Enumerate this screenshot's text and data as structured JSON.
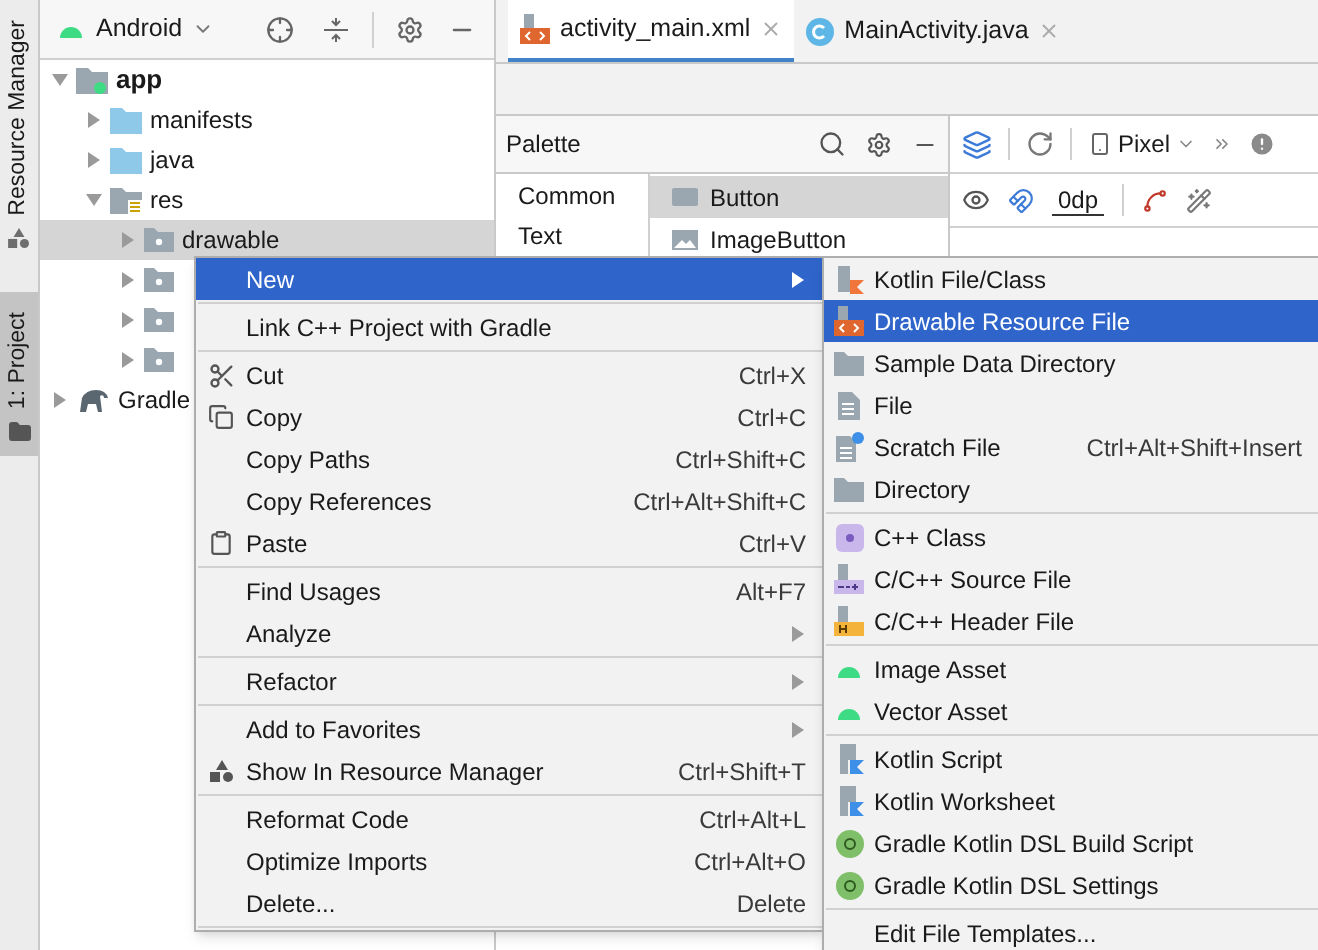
{
  "side_tabs": [
    {
      "label": "Resource Manager",
      "selected": false
    },
    {
      "label": "1: Project",
      "selected": true
    }
  ],
  "project_panel": {
    "view": "Android",
    "tree": [
      {
        "label": "app",
        "kind": "module",
        "expanded": true,
        "selected": false,
        "children": [
          {
            "label": "manifests",
            "kind": "source-folder",
            "expanded": false,
            "selected": false
          },
          {
            "label": "java",
            "kind": "source-folder",
            "expanded": false,
            "selected": false
          },
          {
            "label": "res",
            "kind": "res-folder",
            "expanded": true,
            "selected": false,
            "children": [
              {
                "label": "drawable",
                "kind": "folder",
                "expanded": false,
                "selected": true
              },
              {
                "kind": "folder",
                "expanded": false,
                "selected": false
              },
              {
                "kind": "folder",
                "expanded": false,
                "selected": false
              },
              {
                "kind": "folder",
                "expanded": false,
                "selected": false
              }
            ]
          }
        ]
      },
      {
        "label": "Gradle",
        "kind": "gradle",
        "expanded": false,
        "selected": false
      }
    ]
  },
  "editor_tabs": [
    {
      "label": "activity_main.xml",
      "kind": "xml",
      "selected": true
    },
    {
      "label": "MainActivity.java",
      "kind": "class",
      "selected": false
    }
  ],
  "palette": {
    "title": "Palette",
    "categories": [
      {
        "label": "Common",
        "selected": false
      },
      {
        "label": "Text",
        "selected": false
      }
    ],
    "items": [
      {
        "label": "Button",
        "kind": "button",
        "selected": true
      },
      {
        "label": "ImageButton",
        "kind": "image",
        "selected": false
      }
    ]
  },
  "design_toolbar": {
    "device": "Pixel",
    "margin": "0dp"
  },
  "context_menu": {
    "items": [
      {
        "kind": "item",
        "label": "New",
        "submenu": true,
        "selected": true
      },
      {
        "kind": "separator"
      },
      {
        "kind": "item",
        "label": "Link C++ Project with Gradle",
        "selected": false
      },
      {
        "kind": "separator"
      },
      {
        "kind": "cut",
        "label": "Cut",
        "shortcut": "Ctrl+X",
        "selected": false
      },
      {
        "kind": "copy",
        "label": "Copy",
        "shortcut": "Ctrl+C",
        "selected": false
      },
      {
        "kind": "item",
        "label": "Copy Paths",
        "shortcut": "Ctrl+Shift+C",
        "selected": false
      },
      {
        "kind": "item",
        "label": "Copy References",
        "shortcut": "Ctrl+Alt+Shift+C",
        "selected": false
      },
      {
        "kind": "paste",
        "label": "Paste",
        "shortcut": "Ctrl+V",
        "selected": false
      },
      {
        "kind": "separator"
      },
      {
        "kind": "item",
        "label": "Find Usages",
        "shortcut": "Alt+F7",
        "selected": false
      },
      {
        "kind": "item",
        "label": "Analyze",
        "submenu": true,
        "selected": false
      },
      {
        "kind": "separator"
      },
      {
        "kind": "item",
        "label": "Refactor",
        "submenu": true,
        "selected": false
      },
      {
        "kind": "separator"
      },
      {
        "kind": "item",
        "label": "Add to Favorites",
        "submenu": true,
        "selected": false
      },
      {
        "kind": "resource",
        "label": "Show In Resource Manager",
        "shortcut": "Ctrl+Shift+T",
        "selected": false
      },
      {
        "kind": "separator"
      },
      {
        "kind": "item",
        "label": "Reformat Code",
        "shortcut": "Ctrl+Alt+L",
        "selected": false
      },
      {
        "kind": "item",
        "label": "Optimize Imports",
        "shortcut": "Ctrl+Alt+O",
        "selected": false
      },
      {
        "kind": "item",
        "label": "Delete...",
        "shortcut": "Delete",
        "selected": false
      },
      {
        "kind": "separator"
      }
    ]
  },
  "new_submenu": {
    "items": [
      {
        "kind": "kotlin",
        "label": "Kotlin File/Class",
        "selected": false
      },
      {
        "kind": "drawable",
        "label": "Drawable Resource File",
        "selected": true
      },
      {
        "kind": "folder",
        "label": "Sample Data Directory",
        "selected": false
      },
      {
        "kind": "file",
        "label": "File",
        "selected": false
      },
      {
        "kind": "scratch",
        "label": "Scratch File",
        "shortcut": "Ctrl+Alt+Shift+Insert",
        "selected": false
      },
      {
        "kind": "folder",
        "label": "Directory",
        "selected": false
      },
      {
        "kind": "separator"
      },
      {
        "kind": "cpp-class",
        "label": "C++ Class",
        "selected": false
      },
      {
        "kind": "cpp-source",
        "label": "C/C++ Source File",
        "selected": false
      },
      {
        "kind": "cpp-header",
        "label": "C/C++ Header File",
        "selected": false
      },
      {
        "kind": "separator"
      },
      {
        "kind": "android",
        "label": "Image Asset",
        "selected": false
      },
      {
        "kind": "android",
        "label": "Vector Asset",
        "selected": false
      },
      {
        "kind": "separator"
      },
      {
        "kind": "kotlin-script",
        "label": "Kotlin Script",
        "selected": false
      },
      {
        "kind": "kotlin-script",
        "label": "Kotlin Worksheet",
        "selected": false
      },
      {
        "kind": "gradle",
        "label": "Gradle Kotlin DSL Build Script",
        "selected": false
      },
      {
        "kind": "gradle",
        "label": "Gradle Kotlin DSL Settings",
        "selected": false
      },
      {
        "kind": "separator"
      },
      {
        "kind": "item",
        "label": "Edit File Templates...",
        "selected": false
      }
    ]
  }
}
